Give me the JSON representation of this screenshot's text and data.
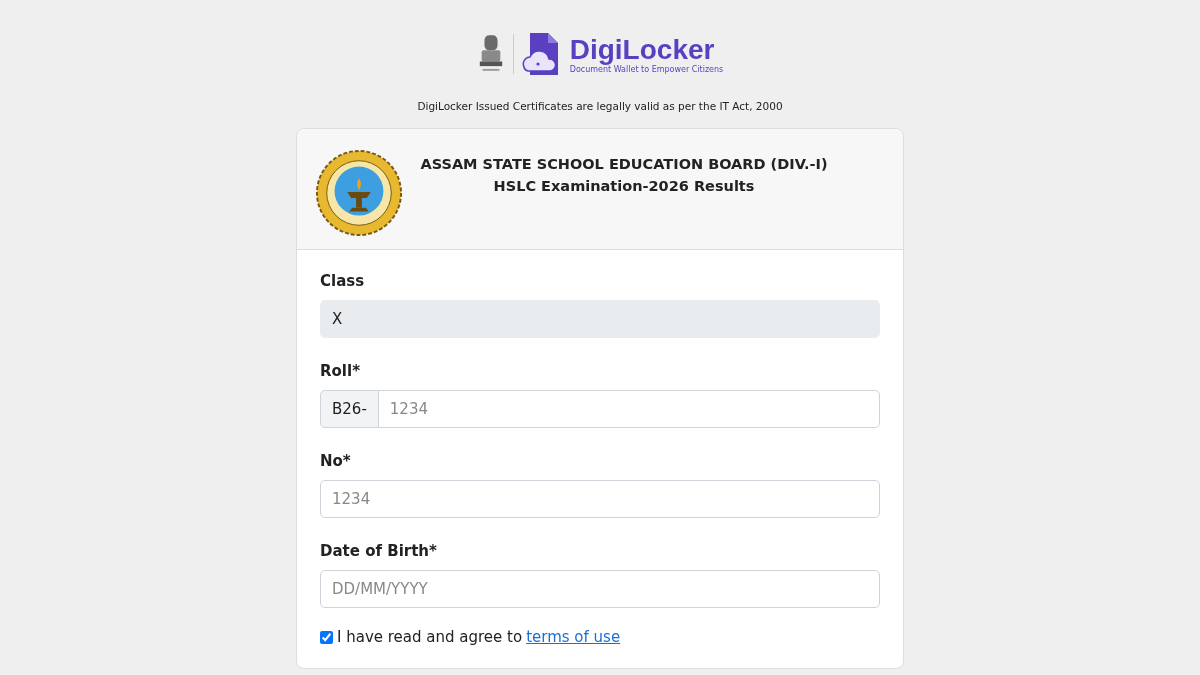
{
  "brand": {
    "name": "DigiLocker",
    "tagline": "Document Wallet to Empower Citizens"
  },
  "notice": "DigiLocker Issued Certificates are legally valid as per the IT Act, 2000",
  "card": {
    "title": "ASSAM STATE SCHOOL EDUCATION BOARD (DIV.-I)",
    "subtitle": "HSLC Examination-2026 Results"
  },
  "fields": [
    {
      "kind": "text",
      "label": "Class",
      "value": "X",
      "disabled": true
    },
    {
      "kind": "prefixed",
      "label": "Roll*",
      "prefix": "B26-",
      "placeholder": "1234",
      "disabled": false
    },
    {
      "kind": "text",
      "label": "No*",
      "placeholder": "1234",
      "disabled": false
    },
    {
      "kind": "text",
      "label": "Date of Birth*",
      "placeholder": "DD/MM/YYYY",
      "disabled": false
    }
  ],
  "consent": {
    "checked": true,
    "text": "I have read and agree to",
    "link": "terms of use"
  }
}
